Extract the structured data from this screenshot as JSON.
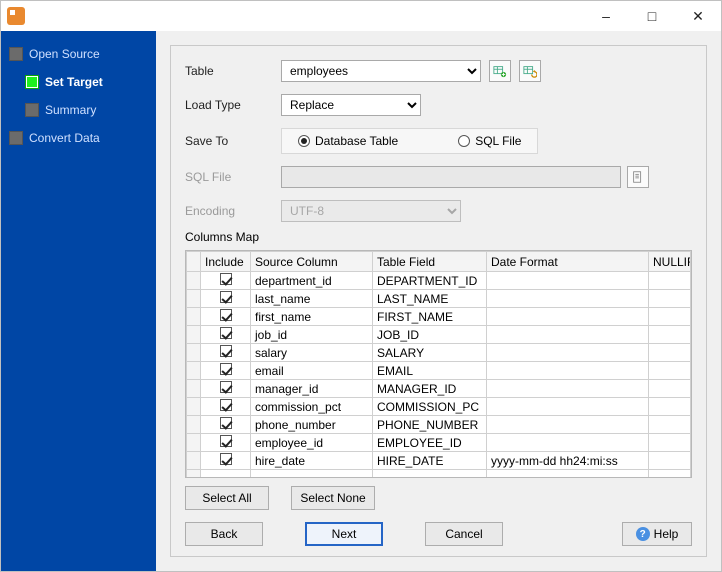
{
  "sidebar": {
    "items": [
      {
        "label": "Open Source"
      },
      {
        "label": "Set Target"
      },
      {
        "label": "Summary"
      },
      {
        "label": "Convert Data"
      }
    ]
  },
  "form": {
    "table_label": "Table",
    "table_value": "employees",
    "loadtype_label": "Load Type",
    "loadtype_value": "Replace",
    "saveto_label": "Save To",
    "saveto_opt_db": "Database Table",
    "saveto_opt_sql": "SQL File",
    "sqlfile_label": "SQL File",
    "sqlfile_value": "",
    "encoding_label": "Encoding",
    "encoding_value": "UTF-8",
    "columns_map_label": "Columns Map"
  },
  "grid": {
    "headers": {
      "include": "Include",
      "source": "Source Column",
      "table": "Table Field",
      "date": "Date Format",
      "nullif": "NULLIF"
    },
    "rows": [
      {
        "include": true,
        "source": "department_id",
        "table": "DEPARTMENT_ID",
        "date": "",
        "nullif": ""
      },
      {
        "include": true,
        "source": "last_name",
        "table": "LAST_NAME",
        "date": "",
        "nullif": ""
      },
      {
        "include": true,
        "source": "first_name",
        "table": "FIRST_NAME",
        "date": "",
        "nullif": ""
      },
      {
        "include": true,
        "source": "job_id",
        "table": "JOB_ID",
        "date": "",
        "nullif": ""
      },
      {
        "include": true,
        "source": "salary",
        "table": "SALARY",
        "date": "",
        "nullif": ""
      },
      {
        "include": true,
        "source": "email",
        "table": "EMAIL",
        "date": "",
        "nullif": ""
      },
      {
        "include": true,
        "source": "manager_id",
        "table": "MANAGER_ID",
        "date": "",
        "nullif": ""
      },
      {
        "include": true,
        "source": "commission_pct",
        "table": "COMMISSION_PC",
        "date": "",
        "nullif": ""
      },
      {
        "include": true,
        "source": "phone_number",
        "table": "PHONE_NUMBER",
        "date": "",
        "nullif": ""
      },
      {
        "include": true,
        "source": "employee_id",
        "table": "EMPLOYEE_ID",
        "date": "",
        "nullif": ""
      },
      {
        "include": true,
        "source": "hire_date",
        "table": "HIRE_DATE",
        "date": "yyyy-mm-dd hh24:mi:ss",
        "nullif": ""
      }
    ]
  },
  "buttons": {
    "select_all": "Select All",
    "select_none": "Select None",
    "back": "Back",
    "next": "Next",
    "cancel": "Cancel",
    "help": "Help"
  }
}
